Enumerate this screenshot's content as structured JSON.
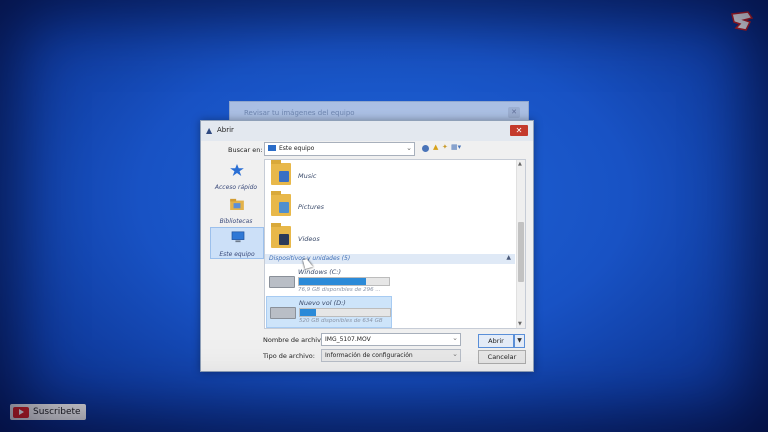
{
  "desktop": {
    "channel_logo": "logo",
    "subscribe_label": "Suscribete"
  },
  "background_dialog": {
    "title": "Revisar tu imágenes del equipo"
  },
  "open_dialog": {
    "title": "Abrir",
    "look_in": {
      "label": "Buscar en:",
      "value": "Este equipo"
    },
    "toolbar": {
      "icons": [
        "back-icon",
        "up-folder-icon",
        "new-folder-icon",
        "views-icon"
      ]
    },
    "places": [
      {
        "label": "Acceso rápido",
        "icon": "star-icon",
        "selected": false
      },
      {
        "label": "Bibliotecas",
        "icon": "library-icon",
        "selected": false
      },
      {
        "label": "Este equipo",
        "icon": "computer-icon",
        "selected": true
      }
    ],
    "folders": [
      {
        "name": "Music",
        "icon": "music-folder-icon"
      },
      {
        "name": "Pictures",
        "icon": "pictures-folder-icon"
      },
      {
        "name": "Videos",
        "icon": "videos-folder-icon"
      }
    ],
    "group_header": "Dispositivos y unidades (5)",
    "drives": [
      {
        "name": "Windows (C:)",
        "free_text": "76,9 GB disponibles de 296 ...",
        "used_fraction": 0.74,
        "selected": false
      },
      {
        "name": "Nuevo vol (D:)",
        "free_text": "520 GB disponibles de 634 GB",
        "used_fraction": 0.18,
        "selected": true
      }
    ],
    "file_name": {
      "label": "Nombre de archivo:",
      "value": "IMG_5107.MOV"
    },
    "file_type": {
      "label": "Tipo de archivo:",
      "value": "Información de configuración"
    },
    "buttons": {
      "open": "Abrir",
      "cancel": "Cancelar"
    },
    "colors": {
      "accent": "#2b8ad8",
      "close_button": "#c43a2c",
      "desktop_blue": "#1852c4"
    }
  }
}
